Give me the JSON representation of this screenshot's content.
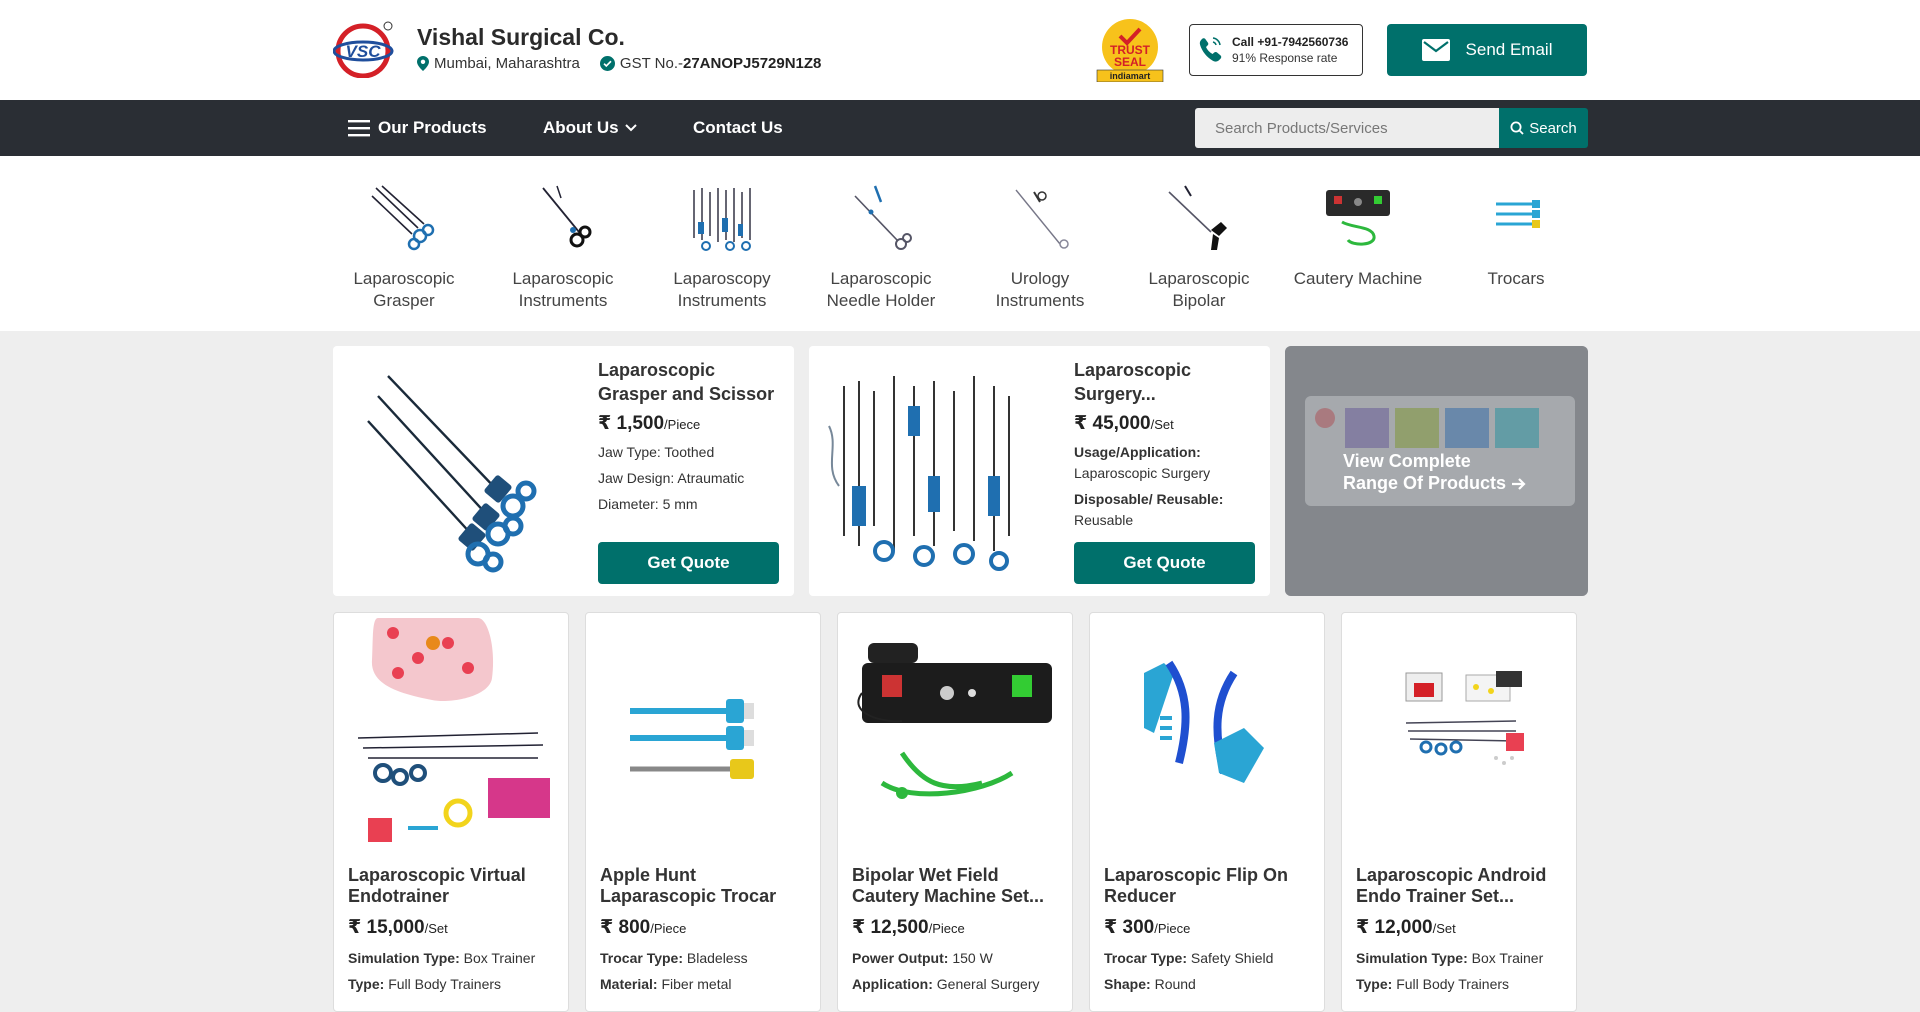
{
  "header": {
    "company_name": "Vishal Surgical Co.",
    "location": "Mumbai, Maharashtra",
    "gst_label": "GST No.-",
    "gst_value": "27ANOPJ5729N1Z8",
    "logo_text": "VSC",
    "trust_seal_lines": [
      "TRUST",
      "SEAL",
      "indiamart"
    ],
    "call_label": "Call +91-7942560736",
    "response_rate": "91% Response rate",
    "email_button": "Send Email"
  },
  "nav": {
    "products": "Our Products",
    "about": "About Us",
    "contact": "Contact Us",
    "search_placeholder": "Search Products/Services",
    "search_button": "Search"
  },
  "categories": [
    {
      "label_1": "Laparoscopic",
      "label_2": "Grasper"
    },
    {
      "label_1": "Laparoscopic",
      "label_2": "Instruments"
    },
    {
      "label_1": "Laparoscopy",
      "label_2": "Instruments"
    },
    {
      "label_1": "Laparoscopic",
      "label_2": "Needle Holder"
    },
    {
      "label_1": "Urology",
      "label_2": "Instruments"
    },
    {
      "label_1": "Laparoscopic",
      "label_2": "Bipolar"
    },
    {
      "label_1": "Cautery Machine",
      "label_2": ""
    },
    {
      "label_1": "Trocars",
      "label_2": ""
    }
  ],
  "featured": [
    {
      "title": "Laparoscopic Grasper and Scissor",
      "price": "₹ 1,500",
      "unit": "/Piece",
      "specs": [
        {
          "key": "Jaw Type:",
          "value": "Toothed"
        },
        {
          "key": "Jaw Design:",
          "value": "Atraumatic"
        },
        {
          "key": "Diameter:",
          "value": "5 mm"
        }
      ],
      "button": "Get Quote"
    },
    {
      "title": "Laparoscopic Surgery...",
      "price": "₹ 45,000",
      "unit": "/Set",
      "specs": [
        {
          "key": "Usage/Application:",
          "value": "Laparoscopic Surgery"
        },
        {
          "key": "Disposable/ Reusable:",
          "value": "Reusable"
        }
      ],
      "button": "Get Quote"
    }
  ],
  "view_range": {
    "line1": "View Complete",
    "line2": "Range Of Products"
  },
  "products": [
    {
      "title": "Laparoscopic Virtual Endotrainer",
      "price": "₹ 15,000",
      "unit": "/Set",
      "specs": [
        {
          "key": "Simulation Type:",
          "value": "Box Trainer"
        },
        {
          "key": "Type:",
          "value": "Full Body Trainers"
        }
      ]
    },
    {
      "title": "Apple Hunt Laparascopic Trocar",
      "price": "₹ 800",
      "unit": "/Piece",
      "specs": [
        {
          "key": "Trocar Type:",
          "value": "Bladeless"
        },
        {
          "key": "Material:",
          "value": "Fiber metal"
        }
      ]
    },
    {
      "title": "Bipolar Wet Field Cautery Machine Set...",
      "price": "₹ 12,500",
      "unit": "/Piece",
      "specs": [
        {
          "key": "Power Output:",
          "value": "150 W"
        },
        {
          "key": "Application:",
          "value": "General Surgery"
        }
      ]
    },
    {
      "title": "Laparoscopic Flip On Reducer",
      "price": "₹ 300",
      "unit": "/Piece",
      "specs": [
        {
          "key": "Trocar Type:",
          "value": "Safety Shield"
        },
        {
          "key": "Shape:",
          "value": "Round"
        }
      ]
    },
    {
      "title": "Laparoscopic Android Endo Trainer Set...",
      "price": "₹ 12,000",
      "unit": "/Set",
      "specs": [
        {
          "key": "Simulation Type:",
          "value": "Box Trainer"
        },
        {
          "key": "Type:",
          "value": "Full Body Trainers"
        }
      ]
    }
  ],
  "colors": {
    "brand_teal": "#00706b",
    "nav_dark": "#2a2e34",
    "logo_red": "#d42027",
    "logo_blue": "#1f4e9c",
    "seal_yellow": "#f7c21b"
  }
}
